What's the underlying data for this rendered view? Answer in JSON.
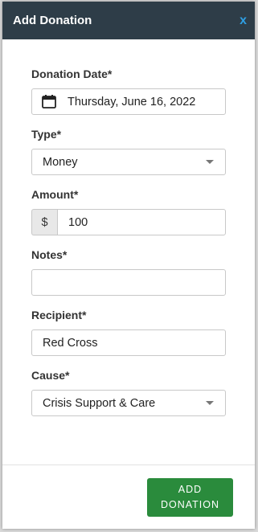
{
  "modal": {
    "title": "Add Donation",
    "close_label": "x"
  },
  "form": {
    "donation_date": {
      "label": "Donation Date*",
      "value": "Thursday, June 16, 2022",
      "icon": "calendar-icon"
    },
    "type": {
      "label": "Type*",
      "value": "Money"
    },
    "amount": {
      "label": "Amount*",
      "prefix": "$",
      "value": "100"
    },
    "notes": {
      "label": "Notes*",
      "value": ""
    },
    "recipient": {
      "label": "Recipient*",
      "value": "Red Cross"
    },
    "cause": {
      "label": "Cause*",
      "value": "Crisis Support & Care"
    }
  },
  "footer": {
    "submit_line1": "ADD",
    "submit_line2": "DONATION"
  },
  "colors": {
    "header_bg": "#2e3d48",
    "close_accent": "#2f9fe3",
    "submit_bg": "#2a8b3c"
  }
}
